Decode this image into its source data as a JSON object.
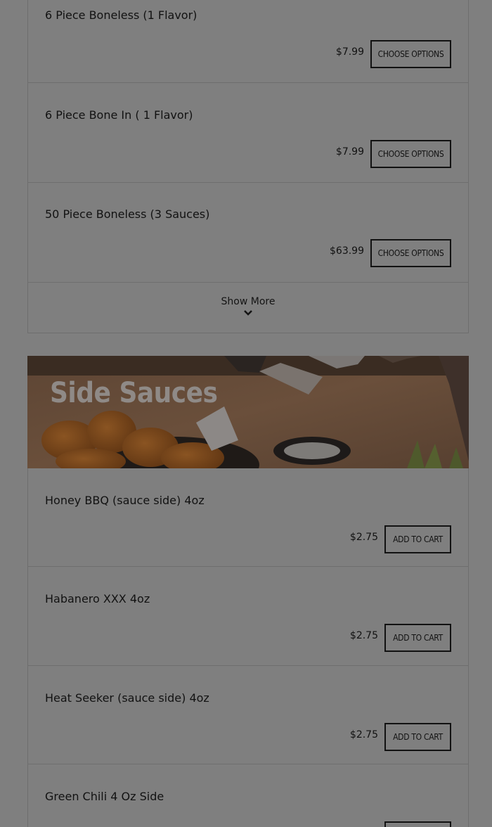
{
  "top_items": [
    {
      "name": "6 Piece Boneless (1 Flavor)",
      "price": "$7.99",
      "button": "Choose Options"
    },
    {
      "name": "6 Piece Bone In ( 1 Flavor)",
      "price": "$7.99",
      "button": "Choose Options"
    },
    {
      "name": "50 Piece Boneless (3 Sauces)",
      "price": "$63.99",
      "button": "Choose Options"
    }
  ],
  "show_more": {
    "label": "Show More",
    "icon": "chevron-down-icon"
  },
  "section": {
    "title": "Side Sauces"
  },
  "sauce_items": [
    {
      "name": "Honey BBQ (sauce side) 4oz",
      "price": "$2.75",
      "button": "Add To Cart"
    },
    {
      "name": "Habanero XXX 4oz",
      "price": "$2.75",
      "button": "Add To Cart"
    },
    {
      "name": "Heat Seeker (sauce side) 4oz",
      "price": "$2.75",
      "button": "Add To Cart"
    },
    {
      "name": "Green Chili 4 Oz Side",
      "price": "",
      "button": ""
    }
  ],
  "colors": {
    "overlay": "#7f7f7f",
    "text": "#121212",
    "border": "#6e6e6e"
  }
}
